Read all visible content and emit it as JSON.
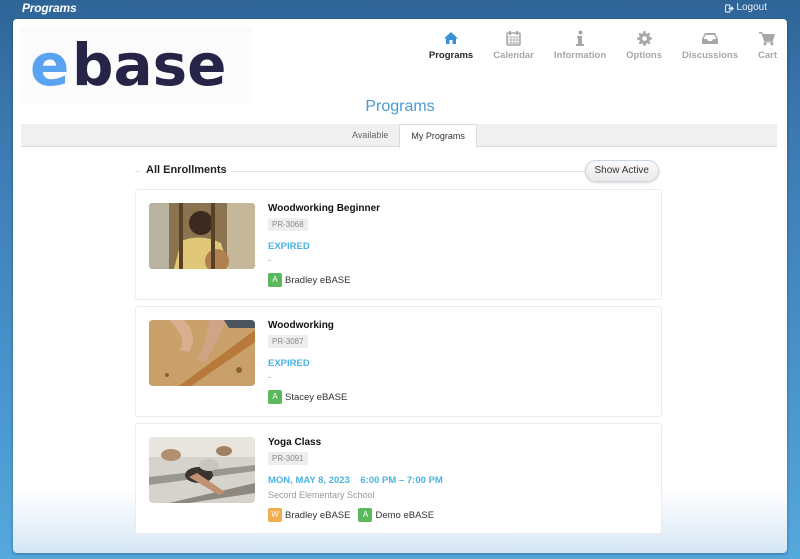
{
  "topbar": {
    "app_title": "Programs",
    "logout_label": "Logout",
    "logout_icon": "sign-out-icon"
  },
  "logo": {
    "text_accent": "e",
    "text_main": "base",
    "accent_color": "#5aa2f2",
    "main_color": "#262447"
  },
  "nav": {
    "items": [
      {
        "label": "Programs",
        "icon": "home-icon",
        "active": true
      },
      {
        "label": "Calendar",
        "icon": "calendar-icon",
        "active": false
      },
      {
        "label": "Information",
        "icon": "info-icon",
        "active": false
      },
      {
        "label": "Options",
        "icon": "gear-icon",
        "active": false
      },
      {
        "label": "Discussions",
        "icon": "inbox-icon",
        "active": false
      },
      {
        "label": "Cart",
        "icon": "cart-icon",
        "active": false
      }
    ]
  },
  "page": {
    "title": "Programs",
    "tabs": [
      {
        "label": "Available",
        "active": false
      },
      {
        "label": "My Programs",
        "active": true
      }
    ]
  },
  "enrollments": {
    "section_title": "All Enrollments",
    "show_active_label": "Show Active",
    "items": [
      {
        "name": "Woodworking Beginner",
        "code": "PR-3068",
        "status": "EXPIRED",
        "detail": "-",
        "participants": [
          {
            "badge": "A",
            "badge_color": "#5cb85c",
            "name": "Bradley eBASE"
          }
        ]
      },
      {
        "name": "Woodworking",
        "code": "PR-3087",
        "status": "EXPIRED",
        "detail": "-",
        "participants": [
          {
            "badge": "A",
            "badge_color": "#5cb85c",
            "name": "Stacey eBASE"
          }
        ]
      },
      {
        "name": "Yoga Class",
        "code": "PR-3091",
        "status": "MON, MAY 8, 2023    6:00 PM – 7:00 PM",
        "detail": "Secord Elementary School",
        "participants": [
          {
            "badge": "W",
            "badge_color": "#f0ad4e",
            "name": "Bradley eBASE"
          },
          {
            "badge": "A",
            "badge_color": "#5cb85c",
            "name": "Demo eBASE"
          }
        ]
      }
    ]
  }
}
